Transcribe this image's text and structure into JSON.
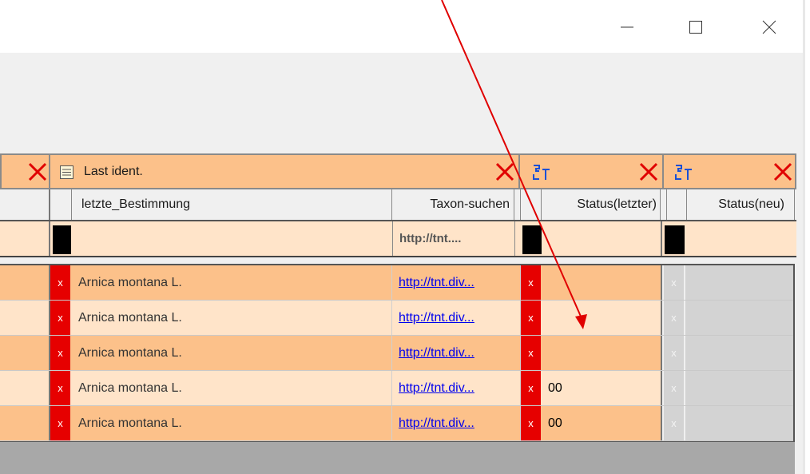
{
  "window": {
    "minimize_icon": "minimize-icon",
    "maximize_icon": "maximize-icon",
    "close_icon": "close-icon"
  },
  "groups": [
    {
      "label": "",
      "icon": "remove-x-icon"
    },
    {
      "label": "Last ident.",
      "icon": "form-icon",
      "close_icon": "remove-x-icon"
    },
    {
      "label": "",
      "icon": "sort-icon",
      "close_icon": "remove-x-icon"
    },
    {
      "label": "",
      "icon": "sort-icon",
      "close_icon": "remove-x-icon"
    }
  ],
  "columns": {
    "bestimmung": "letzte_Bestimmung",
    "taxon": "Taxon-suchen",
    "status_letzter": "Status(letzter)",
    "status_neu": "Status(neu)"
  },
  "filter": {
    "taxon_value": "http://tnt...."
  },
  "rows": [
    {
      "marker": "x",
      "bestimmung": "Arnica montana L.",
      "taxon": "http://tnt.div...",
      "status_marker": "x",
      "status_letzter": "",
      "neu_marker": "x"
    },
    {
      "marker": "x",
      "bestimmung": "Arnica montana L.",
      "taxon": "http://tnt.div...",
      "status_marker": "x",
      "status_letzter": "",
      "neu_marker": "x"
    },
    {
      "marker": "x",
      "bestimmung": "Arnica montana L.",
      "taxon": "http://tnt.div...",
      "status_marker": "x",
      "status_letzter": "",
      "neu_marker": "x"
    },
    {
      "marker": "x",
      "bestimmung": "Arnica montana L.",
      "taxon": "http://tnt.div...",
      "status_marker": "x",
      "status_letzter": "00",
      "neu_marker": "x"
    },
    {
      "marker": "x",
      "bestimmung": "Arnica montana L.",
      "taxon": "http://tnt.div...",
      "status_marker": "x",
      "status_letzter": "00",
      "neu_marker": "x"
    }
  ],
  "colors": {
    "header_orange": "#fcc18a",
    "row_dark": "#fcc18a",
    "row_light": "#ffe4c9",
    "red_marker": "#e60000",
    "annotation_arrow": "#e00000"
  }
}
